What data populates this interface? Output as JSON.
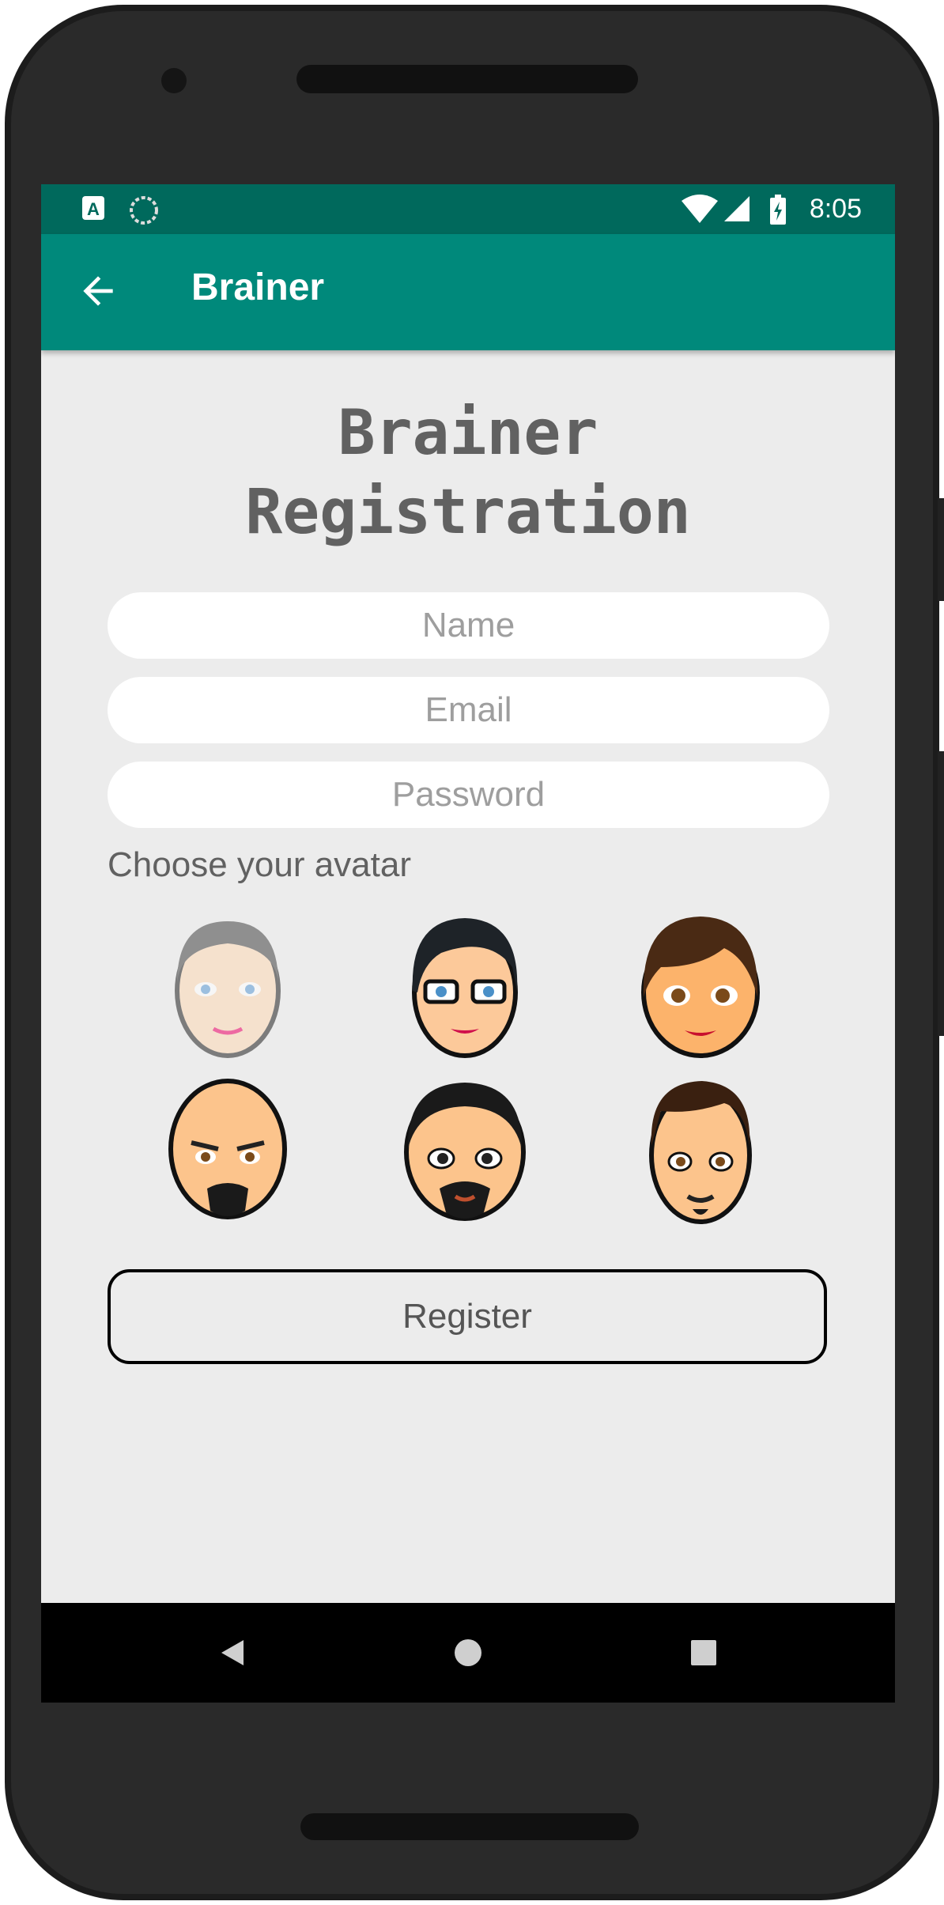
{
  "status_bar": {
    "time": "8:05"
  },
  "app_bar": {
    "title": "Brainer"
  },
  "heading": {
    "line1": "Brainer",
    "line2": "Registration"
  },
  "form": {
    "name_placeholder": "Name",
    "email_placeholder": "Email",
    "password_placeholder": "Password",
    "avatar_prompt": "Choose your avatar",
    "register_label": "Register"
  },
  "avatars": [
    "male-gray-hair-avatar",
    "female-glasses-avatar",
    "female-brown-hair-avatar",
    "bald-goatee-avatar",
    "bearded-man-avatar",
    "young-man-avatar"
  ],
  "colors": {
    "status_bar": "#00695c",
    "app_bar": "#00897b",
    "background": "#ececec",
    "accent": "#c2185b"
  }
}
